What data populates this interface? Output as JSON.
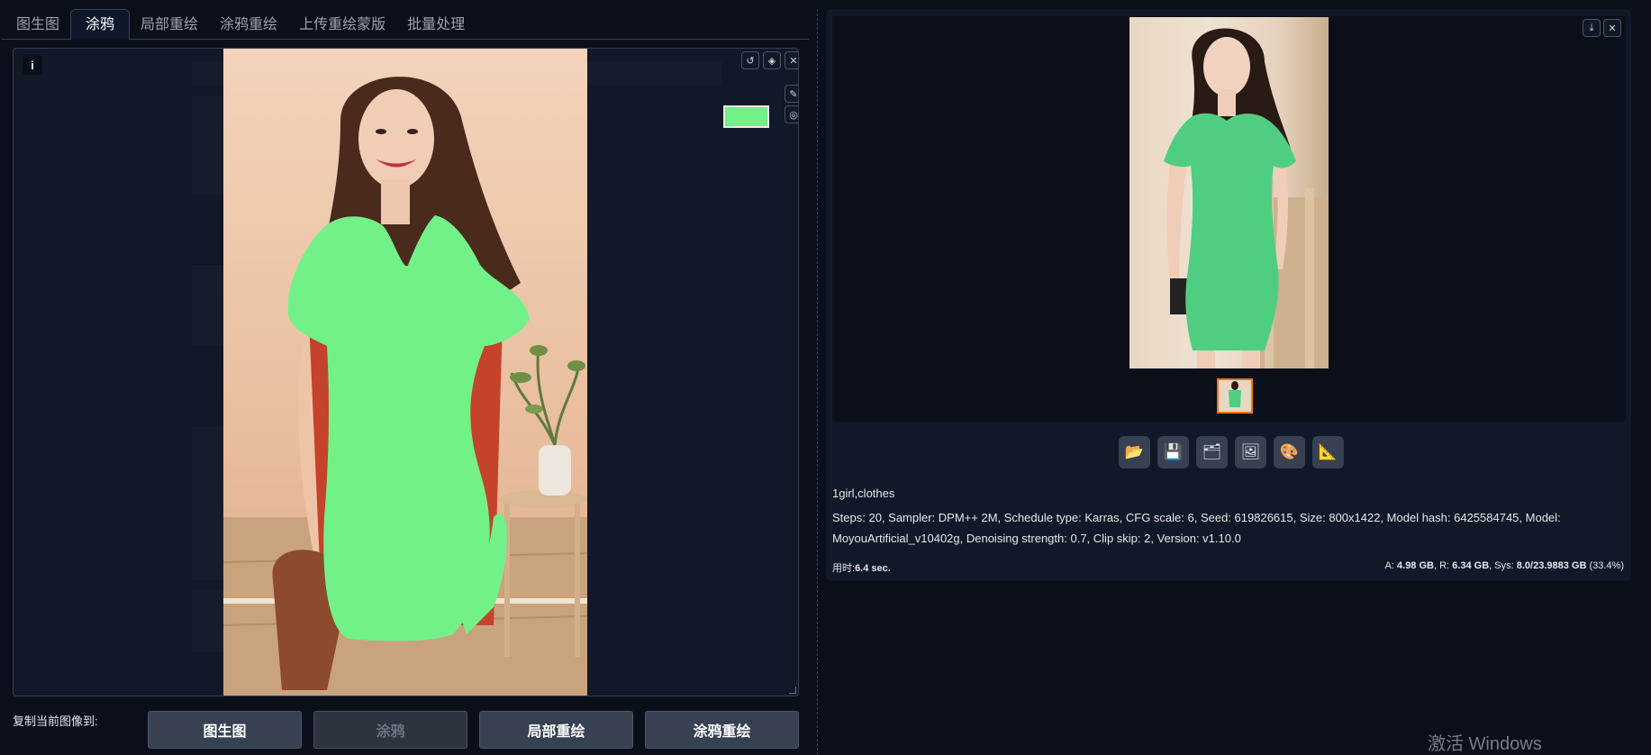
{
  "tabs": [
    "图生图",
    "涂鸦",
    "局部重绘",
    "涂鸦重绘",
    "上传重绘蒙版",
    "批量处理"
  ],
  "active_tab": "涂鸦",
  "editor": {
    "info_label": "i",
    "mask_color": "#72f188"
  },
  "copy_to": {
    "label": "复制当前图像到:",
    "buttons": [
      {
        "label": "图生图",
        "enabled": true
      },
      {
        "label": "涂鸦",
        "enabled": false
      },
      {
        "label": "局部重绘",
        "enabled": true
      },
      {
        "label": "涂鸦重绘",
        "enabled": true
      }
    ]
  },
  "result": {
    "prompt": "1girl,clothes",
    "params": "Steps: 20, Sampler: DPM++ 2M, Schedule type: Karras, CFG scale: 6, Seed: 619826615, Size: 800x1422, Model hash: 6425584745, Model: MoyouArtificial_v10402g, Denoising strength: 0.7, Clip skip: 2, Version: v1.10.0",
    "time_label": "用时:",
    "time_value": "6.4 sec.",
    "mem": {
      "a_label": "A:",
      "a_value": "4.98 GB",
      "r_label": "R:",
      "r_value": "6.34 GB",
      "sys_label": "Sys:",
      "sys_value": "8.0/23.9883 GB",
      "sys_pct": "(33.4%)"
    }
  },
  "action_icons": [
    "folder-icon",
    "save-icon",
    "zip-icon",
    "image-icon",
    "palette-icon",
    "ruler-icon"
  ],
  "watermark": "激活 Windows",
  "colors": {
    "accent": "#f97316",
    "mask_green": "#72f188",
    "dress_green": "#4fce82"
  }
}
